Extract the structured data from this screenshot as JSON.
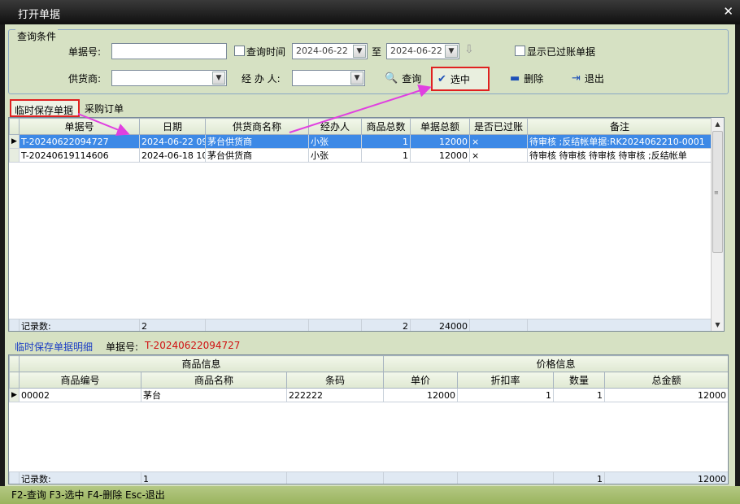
{
  "window": {
    "title": "打开单据",
    "close_glyph": "✕"
  },
  "query": {
    "legend": "查询条件",
    "doc_no_label": "单据号:",
    "doc_no_value": "",
    "query_time_label": "查询时间",
    "date_from": "2024-06-22",
    "to_label": "至",
    "date_to": "2024-06-22",
    "show_closed_label": "显示已过账单据",
    "supplier_label": "供货商:",
    "supplier_value": "",
    "handler_label": "经 办 人:",
    "handler_value": ""
  },
  "buttons": {
    "search": "查询",
    "select": "选中",
    "delete": "删除",
    "exit": "退出"
  },
  "tabs": [
    "临时保存单据",
    "采购订单"
  ],
  "main_grid": {
    "columns": [
      "单据号",
      "日期",
      "供货商名称",
      "经办人",
      "商品总数",
      "单据总额",
      "是否已过账",
      "备注"
    ],
    "rows": [
      {
        "no": "T-20240622094727",
        "date": "2024-06-22  09",
        "supplier": "茅台供货商",
        "handler": "小张",
        "count": "1",
        "total": "12000",
        "posted": "×",
        "note": "待审核 ;反结帐单据:RK2024062210-0001"
      },
      {
        "no": "T-20240619114606",
        "date": "2024-06-18  10",
        "supplier": "茅台供货商",
        "handler": "小张",
        "count": "1",
        "total": "12000",
        "posted": "×",
        "note": "待审核 待审核 待审核 待审核 ;反结帐单"
      }
    ],
    "footer": {
      "label": "记录数:",
      "records": "2",
      "count_sum": "2",
      "total_sum": "24000"
    }
  },
  "detail": {
    "title": "临时保存单据明细",
    "doc_no_label": "单据号:",
    "doc_no_value": "T-20240622094727",
    "group_product": "商品信息",
    "group_price": "价格信息",
    "columns": [
      "商品编号",
      "商品名称",
      "条码",
      "单价",
      "折扣率",
      "数量",
      "总金额"
    ],
    "rows": [
      {
        "code": "00002",
        "name": "茅台",
        "barcode": "222222",
        "price": "12000",
        "discount": "1",
        "qty": "1",
        "amount": "12000"
      }
    ],
    "footer": {
      "label": "记录数:",
      "records": "1",
      "qty_sum": "1",
      "amount_sum": "12000"
    }
  },
  "statusbar": {
    "text": "F2-查询 F3-选中 F4-删除 Esc-退出"
  },
  "colors": {
    "accent_red": "#e02020",
    "select_blue": "#3d89e6",
    "panel_green": "#d6e1c3",
    "annotation_magenta": "#e040e0"
  }
}
